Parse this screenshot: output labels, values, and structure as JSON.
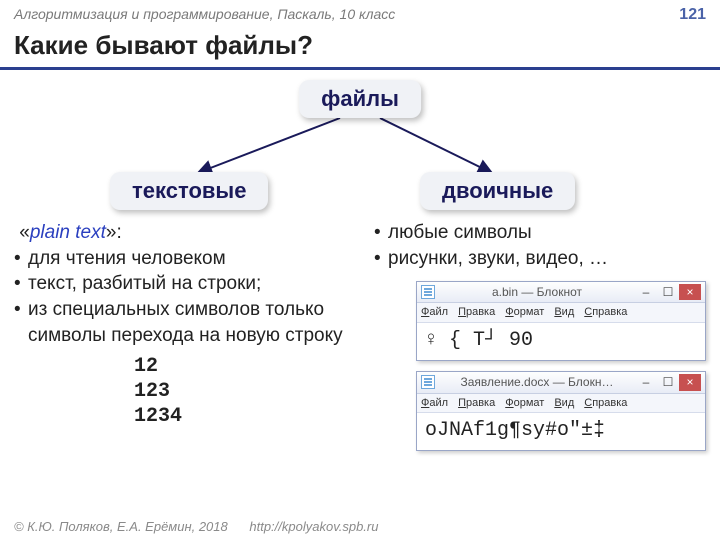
{
  "header": {
    "course": "Алгоритмизация и программирование, Паскаль, 10 класс",
    "page": "121"
  },
  "title": "Какие бывают файлы?",
  "tree": {
    "root": "файлы",
    "left": "текстовые",
    "right": "двоичные"
  },
  "leftcol": {
    "lead_open": "«",
    "lead_term": "plain text",
    "lead_close": "»:",
    "items": [
      "для чтения человеком",
      "текст, разбитый на строки;",
      "из специальных символов только символы перехода на новую строку"
    ],
    "sample": [
      "12",
      "123",
      "1234"
    ]
  },
  "rightcol": {
    "items": [
      "любые символы",
      "рисунки, звуки, видео, …"
    ]
  },
  "win1": {
    "title": "a.bin — Блокнот",
    "menu": [
      "Файл",
      "Правка",
      "Формат",
      "Вид",
      "Справка"
    ],
    "content": "♀   {   T┘   90"
  },
  "win2": {
    "title": "Заявление.docx — Блокн…",
    "menu": [
      "Файл",
      "Правка",
      "Формат",
      "Вид",
      "Справка"
    ],
    "content": "oJNAf1g¶sy#o\"±‡"
  },
  "footer": {
    "copyright": "© К.Ю. Поляков, Е.А. Ерёмин, 2018",
    "url": "http://kpolyakov.spb.ru"
  }
}
